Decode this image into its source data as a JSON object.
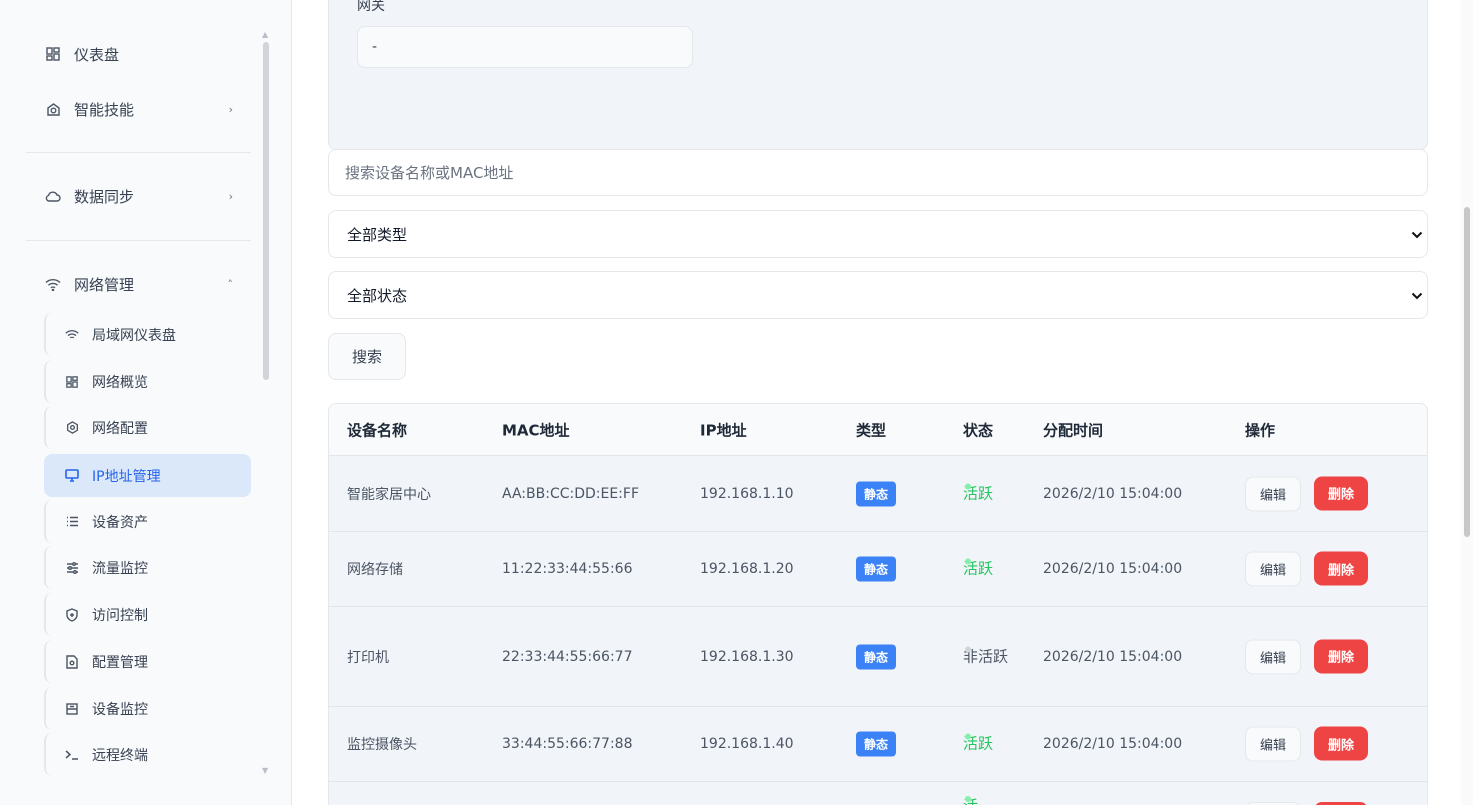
{
  "sidebar": {
    "items": [
      {
        "label": "仪表盘",
        "icon": "dashboard-icon"
      },
      {
        "label": "智能技能",
        "icon": "camera-icon",
        "chevron": "›"
      },
      {
        "label": "数据同步",
        "icon": "cloud-icon",
        "chevron": "›"
      },
      {
        "label": "网络管理",
        "icon": "wifi-icon",
        "chevron": "˄"
      }
    ],
    "subitems": [
      {
        "label": "局域网仪表盘",
        "icon": "wifi-icon"
      },
      {
        "label": "网络概览",
        "icon": "grid-icon"
      },
      {
        "label": "网络配置",
        "icon": "gear-icon"
      },
      {
        "label": "IP地址管理",
        "icon": "monitor-icon",
        "active": true
      },
      {
        "label": "设备资产",
        "icon": "list-icon"
      },
      {
        "label": "流量监控",
        "icon": "sliders-icon"
      },
      {
        "label": "访问控制",
        "icon": "shield-icon"
      },
      {
        "label": "配置管理",
        "icon": "file-settings-icon"
      },
      {
        "label": "设备监控",
        "icon": "panel-icon"
      },
      {
        "label": "远程终端",
        "icon": "terminal-icon"
      }
    ]
  },
  "config": {
    "gateway_label": "网关",
    "gateway_value": "-"
  },
  "filters": {
    "search_placeholder": "搜索设备名称或MAC地址",
    "type_selected": "全部类型",
    "status_selected": "全部状态",
    "search_button": "搜索"
  },
  "table": {
    "headers": [
      "设备名称",
      "MAC地址",
      "IP地址",
      "类型",
      "状态",
      "分配时间",
      "操作"
    ],
    "rows": [
      {
        "name": "智能家居中心",
        "mac": "AA:BB:CC:DD:EE:FF",
        "ip": "192.168.1.10",
        "type": "静态",
        "status": "活跃",
        "time": "2026/2/10 15:04:00",
        "edit": "编辑",
        "delete": "删除"
      },
      {
        "name": "网络存储",
        "mac": "11:22:33:44:55:66",
        "ip": "192.168.1.20",
        "type": "静态",
        "status": "活跃",
        "time": "2026/2/10 15:04:00",
        "edit": "编辑",
        "delete": "删除"
      },
      {
        "name": "打印机",
        "mac": "22:33:44:55:66:77",
        "ip": "192.168.1.30",
        "type": "静态",
        "status": "非活跃",
        "time": "2026/2/10 15:04:00",
        "edit": "编辑",
        "delete": "删除"
      },
      {
        "name": "监控摄像头",
        "mac": "33:44:55:66:77:88",
        "ip": "192.168.1.40",
        "type": "静态",
        "status": "活跃",
        "time": "2026/2/10 15:04:00",
        "edit": "编辑",
        "delete": "删除"
      },
      {
        "name": "",
        "mac": "",
        "ip": "",
        "type": "",
        "status": "活",
        "time": "",
        "edit": "",
        "delete": ""
      }
    ]
  },
  "colors": {
    "accent": "#2563eb",
    "badge": "#3b82f6",
    "active_status": "#22c55e",
    "danger": "#ef4444"
  }
}
